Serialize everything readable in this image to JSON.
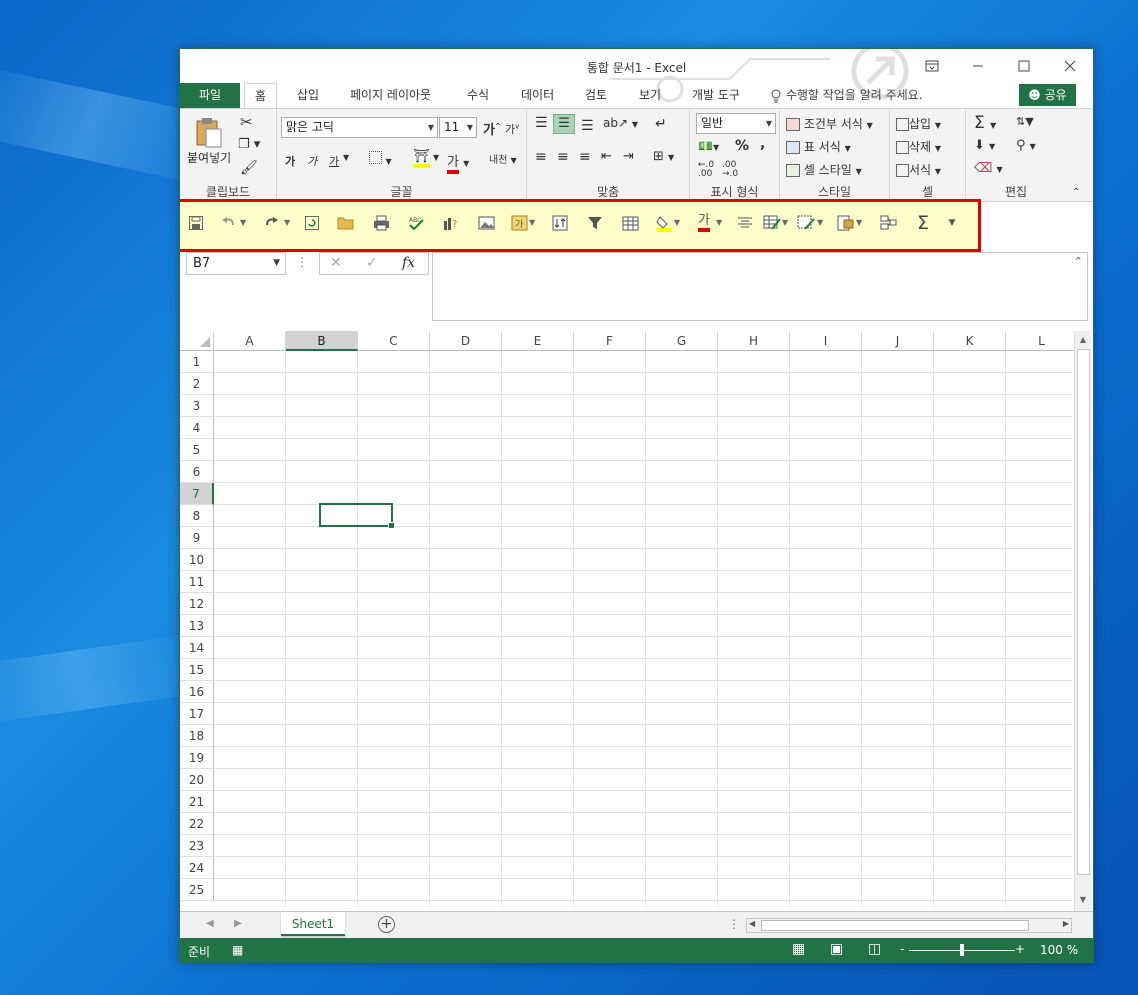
{
  "window": {
    "title": "통합 문서1 - Excel",
    "controls": [
      "restore-ribbon",
      "minimize",
      "maximize",
      "close"
    ]
  },
  "tabs": {
    "file": "파일",
    "items": [
      "홈",
      "삽입",
      "페이지 레이아웃",
      "수식",
      "데이터",
      "검토",
      "보기",
      "개발 도구"
    ],
    "active": "홈",
    "tell_me": "수행할 작업을 알려 주세요.",
    "share": "공유"
  },
  "ribbon": {
    "clipboard": {
      "label": "클립보드",
      "paste": "붙여넣기"
    },
    "font": {
      "label": "글꼴",
      "name": "맑은 고딕",
      "size": "11",
      "grow": "가",
      "shrink": "가",
      "bold": "가",
      "italic": "가",
      "underline": "가",
      "fontcolor": "가",
      "phonetic": "내천"
    },
    "alignment": {
      "label": "맞춤"
    },
    "number": {
      "label": "표시 형식",
      "format": "일반",
      "percent": "%",
      "comma": ","
    },
    "styles": {
      "label": "스타일",
      "conditional": "조건부 서식",
      "table": "표 서식",
      "cell": "셀 스타일"
    },
    "cells": {
      "label": "셀",
      "insert": "삽입",
      "delete": "삭제",
      "format": "서식"
    },
    "editing": {
      "label": "편집"
    }
  },
  "qat": {
    "icons": [
      "save-icon",
      "undo-icon",
      "redo-icon",
      "refresh-icon",
      "open-folder-icon",
      "print-icon",
      "spellcheck-icon",
      "chart-wizard-icon",
      "picture-icon",
      "text-box-icon",
      "sort-icon",
      "filter-icon",
      "table-icon",
      "fill-color-icon",
      "font-color-icon",
      "align-center-icon",
      "format-painter-icon",
      "format-icon",
      "insert-cells-icon",
      "pivot-icon",
      "autosum-icon",
      "customize-icon"
    ],
    "font_color_glyph": "가"
  },
  "formula_bar": {
    "name_box": "B7",
    "fx": "fx",
    "value": ""
  },
  "grid": {
    "columns": [
      "A",
      "B",
      "C",
      "D",
      "E",
      "F",
      "G",
      "H",
      "I",
      "J",
      "K",
      "L"
    ],
    "rows": [
      "1",
      "2",
      "3",
      "4",
      "5",
      "6",
      "7",
      "8",
      "9",
      "10",
      "11",
      "12",
      "13",
      "14",
      "15",
      "16",
      "17",
      "18",
      "19",
      "20",
      "21",
      "22",
      "23",
      "24",
      "25"
    ],
    "selected_column": "B",
    "selected_row": "7"
  },
  "sheets": {
    "tabs": [
      "Sheet1"
    ],
    "active": "Sheet1"
  },
  "status": {
    "mode": "준비",
    "zoom": "100 %",
    "zoom_minus": "-",
    "zoom_plus": "+"
  },
  "colors": {
    "excel_green": "#217346",
    "qat_bg": "#fefeca",
    "qat_border": "#e00000"
  }
}
